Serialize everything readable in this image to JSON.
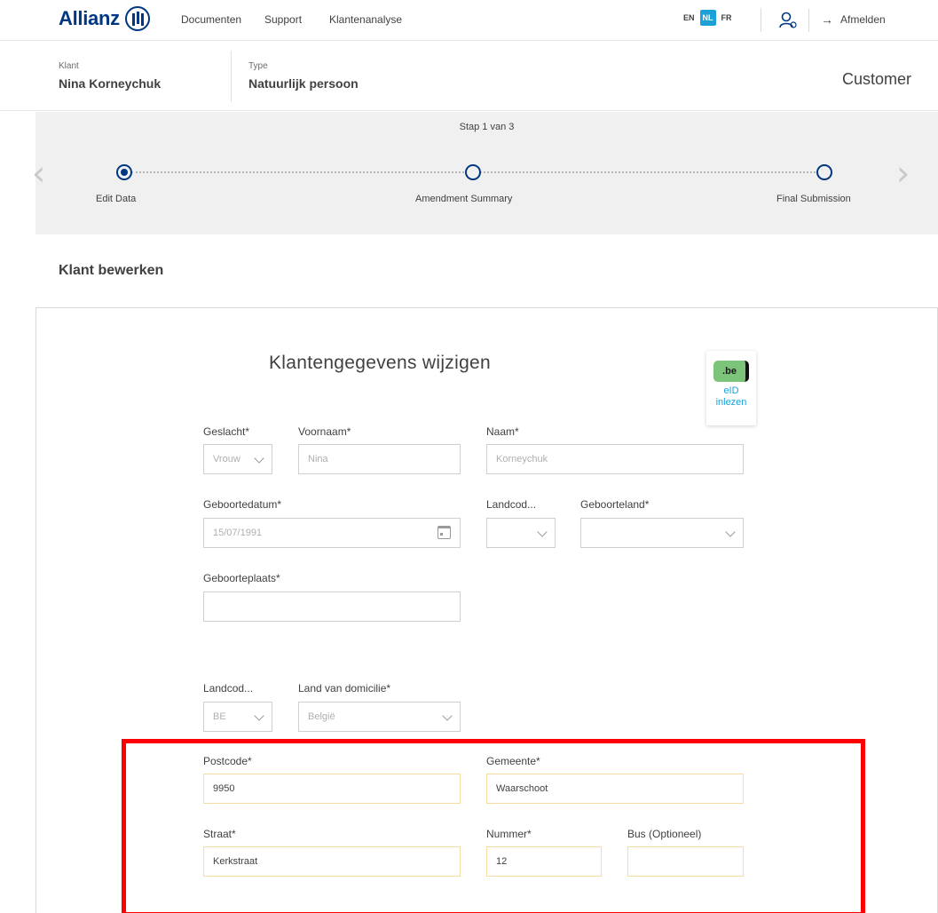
{
  "header": {
    "logo": "Allianz",
    "nav": [
      "Documenten",
      "Support",
      "Klantenanalyse"
    ],
    "languages": [
      "EN",
      "NL",
      "FR"
    ],
    "active_language": "NL",
    "logout_label": "Afmelden"
  },
  "client": {
    "client_label": "Klant",
    "client_name": "Nina Korneychuk",
    "type_label": "Type",
    "type_value": "Natuurlijk persoon",
    "context": "Customer"
  },
  "stepper": {
    "title": "Stap 1 van 3",
    "current_step": 1,
    "steps": [
      {
        "label": "Edit Data"
      },
      {
        "label": "Amendment Summary"
      },
      {
        "label": "Final Submission"
      }
    ]
  },
  "section_title": "Klant bewerken",
  "form": {
    "title": "Klantengegevens wijzigen",
    "eid": {
      "logo": ".be",
      "line1": "eID",
      "line2": "inlezen"
    },
    "fields": {
      "geslacht": {
        "label": "Geslacht*",
        "value": "Vrouw"
      },
      "voornaam": {
        "label": "Voornaam*",
        "value": "Nina"
      },
      "naam": {
        "label": "Naam*",
        "value": "Korneychuk"
      },
      "geboortedatum": {
        "label": "Geboortedatum*",
        "value": "15/07/1991"
      },
      "landcode_geboorte": {
        "label": "Landcod...",
        "value": ""
      },
      "geboorteland": {
        "label": "Geboorteland*",
        "value": ""
      },
      "geboorteplaats": {
        "label": "Geboorteplaats*",
        "value": ""
      },
      "landcode_domicilie": {
        "label": "Landcod...",
        "value": "BE"
      },
      "land_domicilie": {
        "label": "Land van domicilie*",
        "value": "België"
      },
      "postcode": {
        "label": "Postcode*",
        "value": "9950"
      },
      "gemeente": {
        "label": "Gemeente*",
        "value": "Waarschoot"
      },
      "straat": {
        "label": "Straat*",
        "value": "Kerkstraat"
      },
      "nummer": {
        "label": "Nummer*",
        "value": "12"
      },
      "bus": {
        "label": "Bus (Optioneel)",
        "value": ""
      }
    }
  },
  "colors": {
    "brand": "#003781",
    "accent": "#1aa2d9",
    "highlight": "#ff0000",
    "filled_border": "#f5dca0"
  }
}
